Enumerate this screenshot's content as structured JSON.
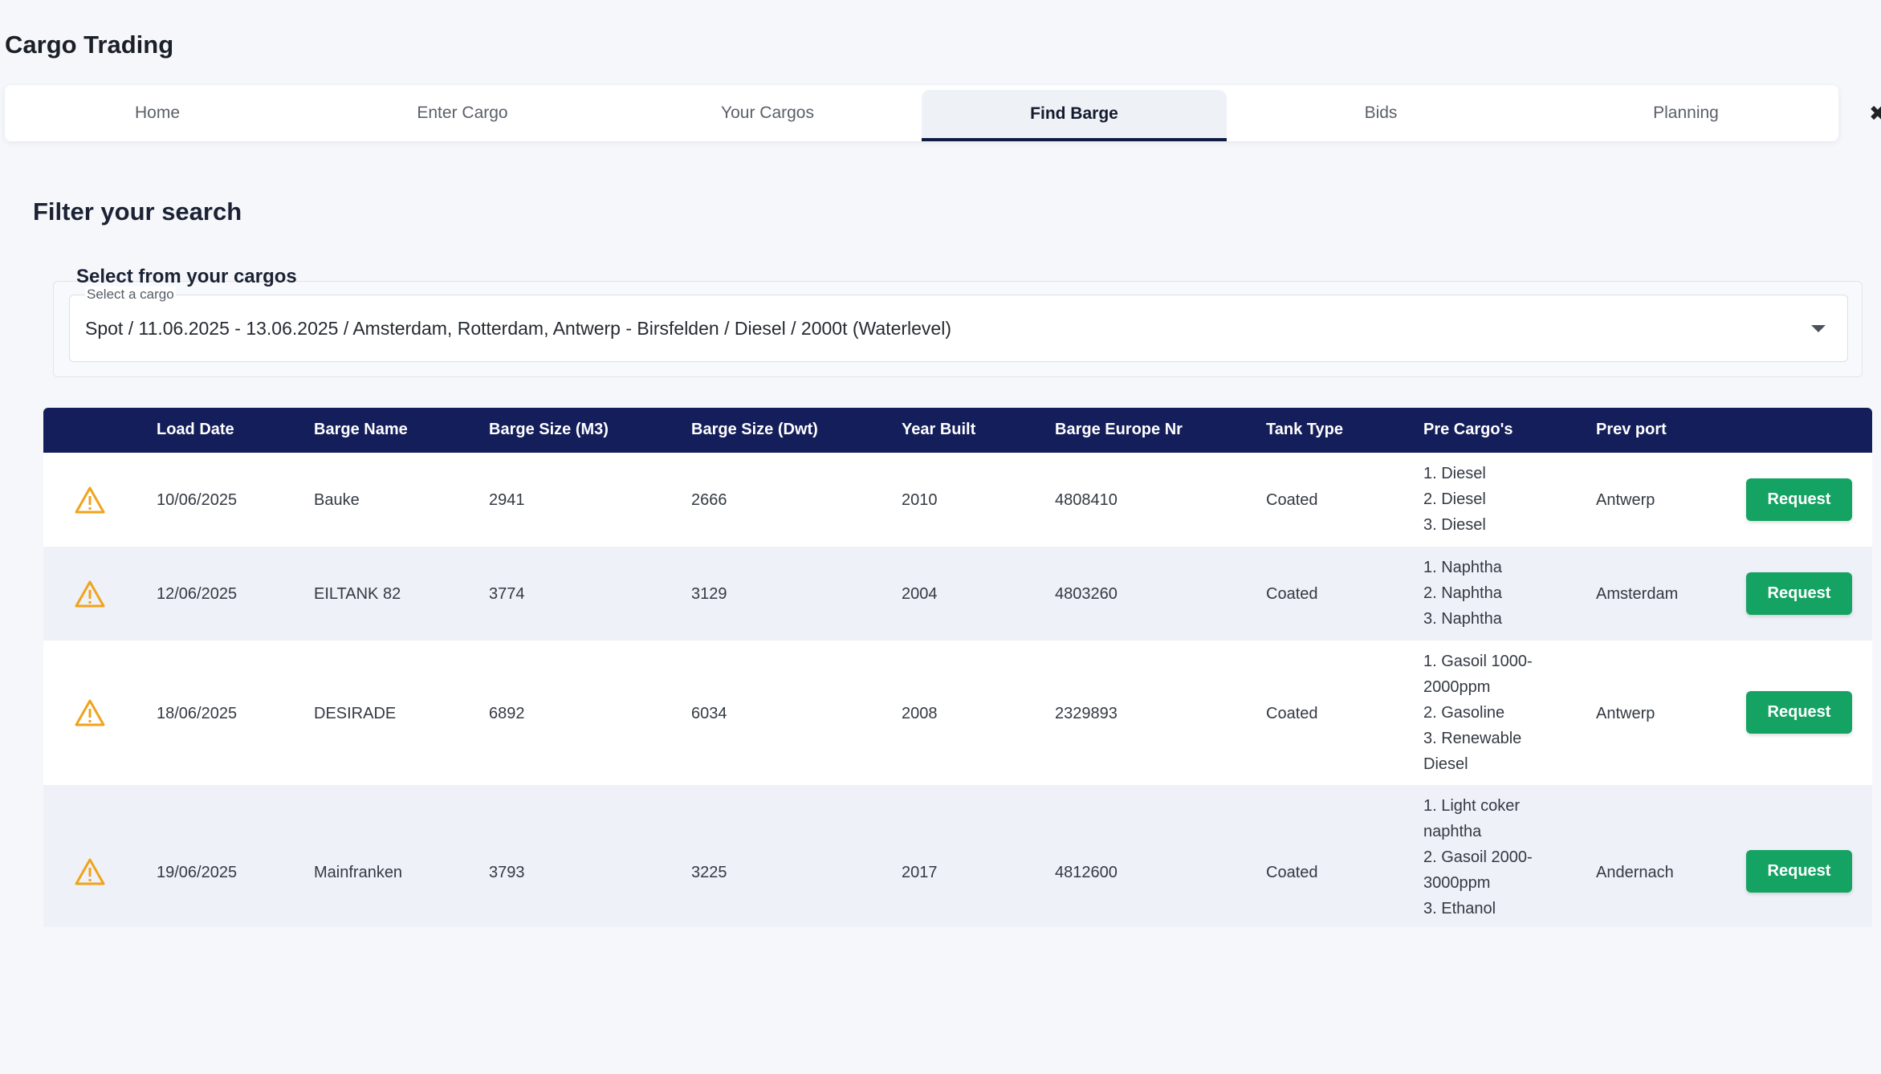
{
  "app": {
    "title": "Cargo Trading"
  },
  "tabs": [
    {
      "label": "Home"
    },
    {
      "label": "Enter Cargo"
    },
    {
      "label": "Your Cargos"
    },
    {
      "label": "Find Barge",
      "active": true
    },
    {
      "label": "Bids"
    },
    {
      "label": "Planning"
    }
  ],
  "tab_end_icon": "✖",
  "filter": {
    "title": "Filter your search",
    "group_label": "Select from your cargos",
    "select_label": "Select a cargo",
    "select_value": "Spot / 11.06.2025 - 13.06.2025 / Amsterdam, Rotterdam, Antwerp - Birsfelden / Diesel / 2000t (Waterlevel)"
  },
  "table": {
    "headers": [
      "Load Date",
      "Barge Name",
      "Barge Size (M3)",
      "Barge Size (Dwt)",
      "Year Built",
      "Barge Europe Nr",
      "Tank Type",
      "Pre Cargo's",
      "Prev port"
    ],
    "rows": [
      {
        "load_date": "10/06/2025",
        "barge_name": "Bauke",
        "size_m3": "2941",
        "size_dwt": "2666",
        "year_built": "2010",
        "europe_nr": "4808410",
        "tank_type": "Coated",
        "pre_cargos": [
          "1. Diesel",
          "2. Diesel",
          "3. Diesel"
        ],
        "prev_port": "Antwerp",
        "action": "Request"
      },
      {
        "load_date": "12/06/2025",
        "barge_name": "EILTANK 82",
        "size_m3": "3774",
        "size_dwt": "3129",
        "year_built": "2004",
        "europe_nr": "4803260",
        "tank_type": "Coated",
        "pre_cargos": [
          "1. Naphtha",
          "2. Naphtha",
          "3. Naphtha"
        ],
        "prev_port": "Amsterdam",
        "action": "Request"
      },
      {
        "load_date": "18/06/2025",
        "barge_name": "DESIRADE",
        "size_m3": "6892",
        "size_dwt": "6034",
        "year_built": "2008",
        "europe_nr": "2329893",
        "tank_type": "Coated",
        "pre_cargos": [
          "1. Gasoil 1000-2000ppm",
          "2. Gasoline",
          "3. Renewable Diesel"
        ],
        "prev_port": "Antwerp",
        "action": "Request"
      },
      {
        "load_date": "19/06/2025",
        "barge_name": "Mainfranken",
        "size_m3": "3793",
        "size_dwt": "3225",
        "year_built": "2017",
        "europe_nr": "4812600",
        "tank_type": "Coated",
        "pre_cargos": [
          "1. Light coker naphtha",
          "2. Gasoil 2000-3000ppm",
          "3. Ethanol"
        ],
        "prev_port": "Andernach",
        "action": "Request"
      }
    ]
  },
  "colors": {
    "header_bg": "#141e5a",
    "request_button": "#15a363",
    "warning": "#f0a31a"
  }
}
